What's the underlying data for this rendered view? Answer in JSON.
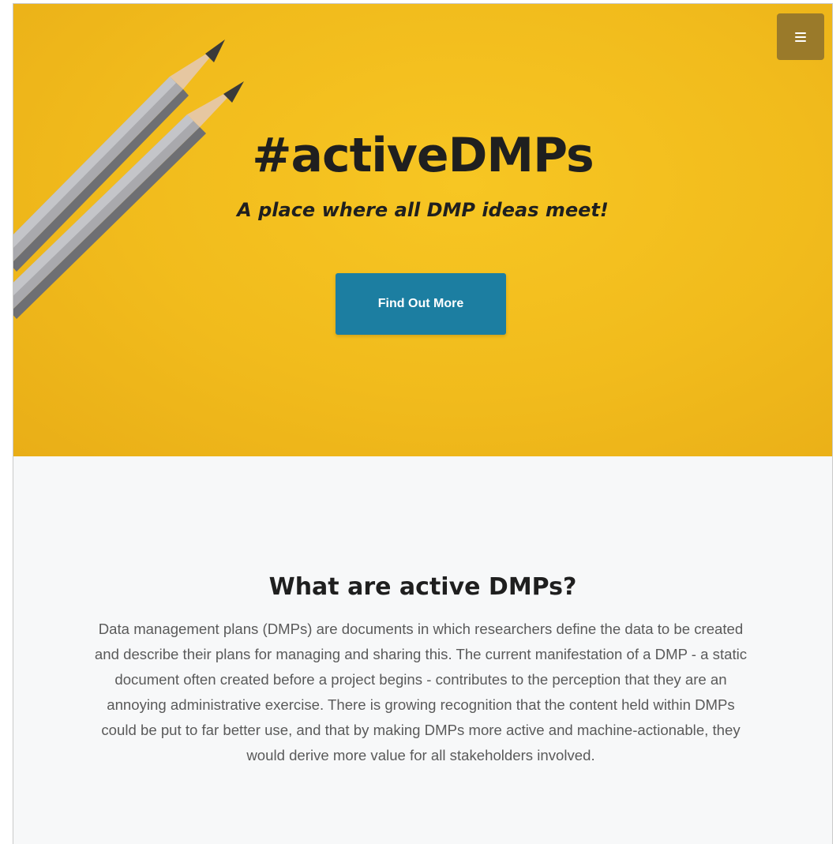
{
  "hero": {
    "title": "#activeDMPs",
    "subtitle": "A place where all DMP ideas meet!",
    "cta_label": "Find Out More"
  },
  "nav": {
    "menu_icon": "hamburger-menu-icon"
  },
  "about": {
    "heading": "What are active DMPs?",
    "body": "Data management plans (DMPs) are documents in which researchers define the data to be created and describe their plans for managing and sharing this. The current manifestation of a DMP - a static document often created before a project begins - contributes to the perception that they are an annoying administrative exercise. There is growing recognition that the content held within DMPs could be put to far better use, and that by making DMPs more active and machine-actionable, they would derive more value for all stakeholders involved."
  },
  "colors": {
    "hero_background": "#f1bb1c",
    "cta_background": "#1c7ea1",
    "menu_button": "#9a7a2a",
    "section_background": "#f7f8f9"
  }
}
